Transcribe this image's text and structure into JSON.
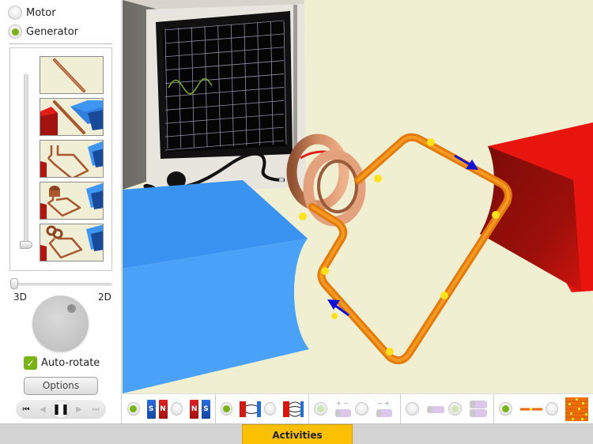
{
  "mode": {
    "options": [
      {
        "label": "Motor",
        "selected": false
      },
      {
        "label": "Generator",
        "selected": true
      }
    ]
  },
  "level_selector": {
    "selected_index": 4,
    "levels": [
      {
        "name": "straight-wire"
      },
      {
        "name": "wire-between-magnets"
      },
      {
        "name": "rectangular-loop-between-magnets"
      },
      {
        "name": "loop-with-commutator"
      },
      {
        "name": "loop-with-slip-rings"
      }
    ]
  },
  "view_slider": {
    "left_label": "3D",
    "right_label": "2D",
    "value_fraction": 0.0
  },
  "auto_rotate": {
    "label": "Auto-rotate",
    "checked": true
  },
  "options_button": {
    "label": "Options"
  },
  "playback": {
    "buttons": [
      {
        "name": "rewind",
        "glyph": "⏮",
        "enabled": true
      },
      {
        "name": "step-back",
        "glyph": "◀",
        "enabled": false
      },
      {
        "name": "pause",
        "glyph": "❚❚",
        "enabled": true
      },
      {
        "name": "step-forward",
        "glyph": "▶",
        "enabled": false
      },
      {
        "name": "skip-end",
        "glyph": "⏭",
        "enabled": false
      }
    ]
  },
  "toolbar": {
    "magnet_orientation": [
      {
        "selected": true,
        "left": "S",
        "right": "N"
      },
      {
        "selected": false,
        "left": "N",
        "right": "S"
      }
    ],
    "field_display": [
      {
        "selected": true,
        "name": "single-field-line"
      },
      {
        "selected": false,
        "name": "multiple-field-lines"
      }
    ],
    "battery_polarity": [
      {
        "selected": false,
        "disabled": true,
        "label": "+ −"
      },
      {
        "selected": false,
        "disabled": true,
        "label": "− +"
      }
    ],
    "battery_count": [
      {
        "selected": false,
        "disabled": true,
        "name": "one-battery"
      },
      {
        "selected": true,
        "disabled": true,
        "name": "two-batteries"
      }
    ],
    "current_display": [
      {
        "selected": true,
        "name": "current-dashes"
      },
      {
        "selected": false,
        "name": "electron-flow"
      }
    ]
  },
  "bottom_tab": {
    "label": "Activities"
  },
  "colors": {
    "accent_green": "#7ab317",
    "scene_background": "#f1efd2",
    "north_magnet": "#e0140f",
    "south_magnet": "#3d97f2",
    "wire": "#f07f08",
    "current_arrow": "#1010d8",
    "activities_tab": "#fbc002"
  }
}
